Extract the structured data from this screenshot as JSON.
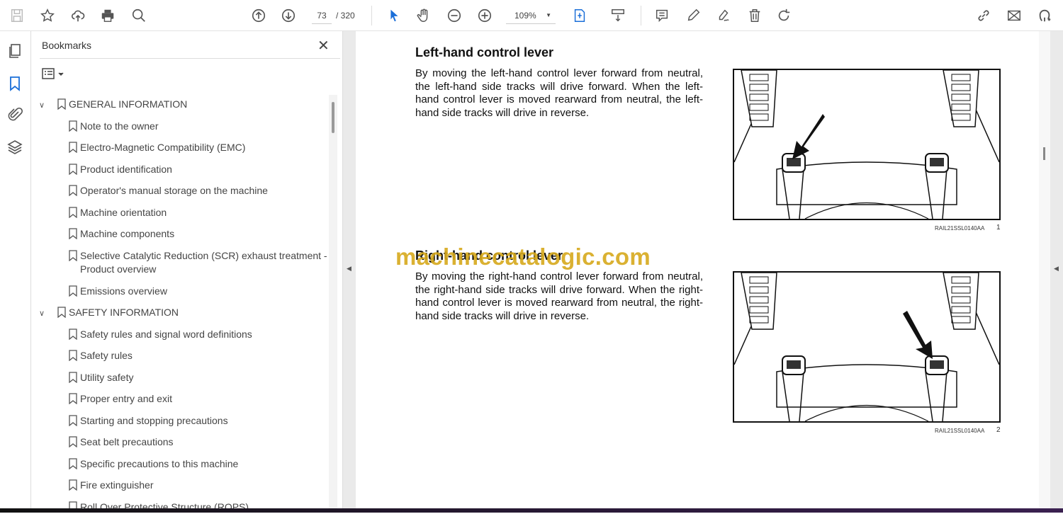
{
  "toolbar": {
    "page_current": "73",
    "page_total": "/ 320",
    "zoom": "109%",
    "icons": [
      "save-icon",
      "star-icon",
      "upload-cloud-icon",
      "print-icon",
      "search-zoom-icon",
      "page-up-icon",
      "page-down-icon",
      "select-cursor-icon",
      "hand-icon",
      "zoom-out-icon",
      "zoom-in-icon",
      "fit-page-icon",
      "scroll-mode-icon",
      "comment-icon",
      "highlight-pen-icon",
      "sign-icon",
      "delete-icon",
      "rotate-icon",
      "share-link-icon",
      "email-icon",
      "account-icon"
    ]
  },
  "bookmarks": {
    "title": "Bookmarks",
    "items": [
      {
        "label": "GENERAL INFORMATION",
        "level": 0
      },
      {
        "label": "Note to the owner",
        "level": 1
      },
      {
        "label": "Electro-Magnetic Compatibility (EMC)",
        "level": 1
      },
      {
        "label": "Product identification",
        "level": 1
      },
      {
        "label": "Operator's manual storage on the machine",
        "level": 1
      },
      {
        "label": "Machine orientation",
        "level": 1
      },
      {
        "label": "Machine components",
        "level": 1
      },
      {
        "label": "Selective Catalytic Reduction (SCR) exhaust treatment -",
        "label2": "Product overview",
        "level": 1
      },
      {
        "label": "Emissions overview",
        "level": 1
      },
      {
        "label": "SAFETY INFORMATION",
        "level": 0
      },
      {
        "label": "Safety rules and signal word definitions",
        "level": 1
      },
      {
        "label": "Safety rules",
        "level": 1
      },
      {
        "label": "Utility safety",
        "level": 1
      },
      {
        "label": "Proper entry and exit",
        "level": 1
      },
      {
        "label": "Starting and stopping precautions",
        "level": 1
      },
      {
        "label": "Seat belt precautions",
        "level": 1
      },
      {
        "label": "Specific precautions to this machine",
        "level": 1
      },
      {
        "label": "Fire extinguisher",
        "level": 1
      },
      {
        "label": "Roll Over Protective Structure (ROPS)",
        "level": 1
      }
    ]
  },
  "document": {
    "s1": {
      "heading": "Left-hand control lever",
      "body": "By moving the left-hand control lever forward from neutral, the left-hand side tracks will drive forward. When the left-hand control lever is moved rearward from neutral, the left-hand side tracks will drive in reverse.",
      "caption": "RAIL21SSL0140AA",
      "num": "1"
    },
    "s2": {
      "heading": "Right-hand control lever",
      "body": "By moving the right-hand control lever forward from neutral, the right-hand side tracks will drive forward. When the right-hand control lever is moved rearward from neutral, the right-hand side tracks will drive in reverse.",
      "caption": "RAIL21SSL0140AA",
      "num": "2"
    },
    "watermark": "machinecatalogic.com"
  }
}
